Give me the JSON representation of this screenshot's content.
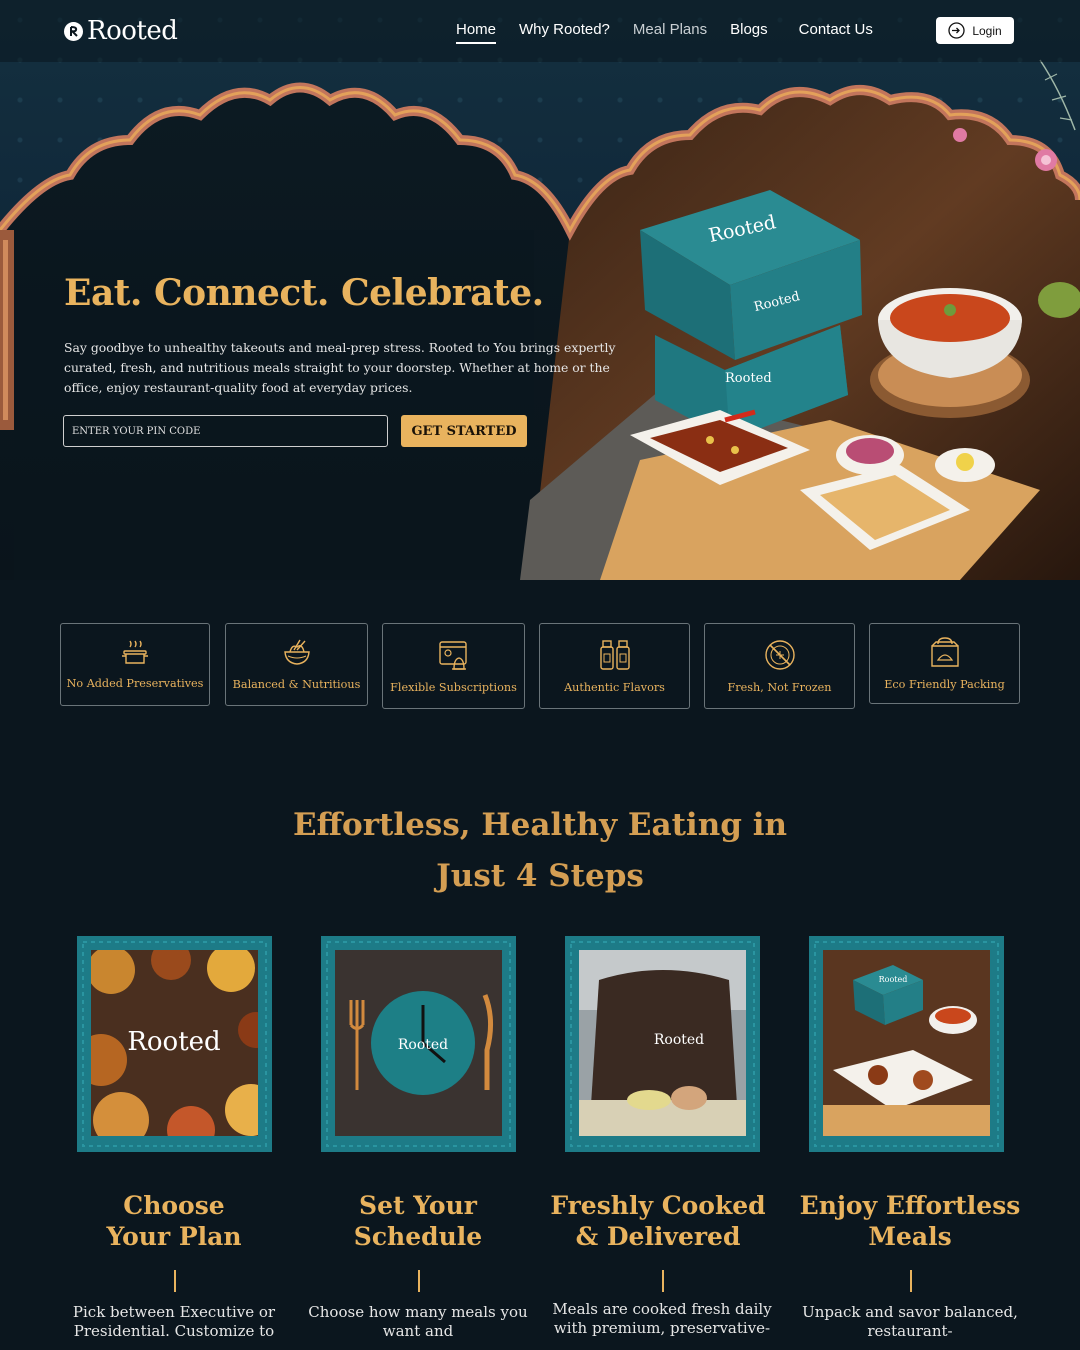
{
  "brand": {
    "name": "Rooted",
    "mark_letter": "R"
  },
  "nav": {
    "links": [
      {
        "label": "Home",
        "active": true
      },
      {
        "label": "Why Rooted?",
        "active": false
      },
      {
        "label": "Meal Plans",
        "active": false
      },
      {
        "label": "Blogs",
        "active": false
      },
      {
        "label": "Contact Us",
        "active": false
      }
    ],
    "login_label": "Login"
  },
  "hero": {
    "title": "Eat. Connect. Celebrate.",
    "description": "Say goodbye to unhealthy takeouts and meal-prep stress. Rooted to You brings expertly curated, fresh, and nutritious meals straight to your doorstep. Whether at home or the office, enjoy restaurant-quality food at everyday prices.",
    "pin_placeholder": "ENTER YOUR PIN CODE",
    "cta_label": "GET STARTED",
    "box_label": "Rooted"
  },
  "features": [
    {
      "label": "No Added Preservatives",
      "icon": "steaming-pot-icon"
    },
    {
      "label": "Balanced & Nutritious",
      "icon": "noodle-bowl-icon"
    },
    {
      "label": "Flexible Subscriptions",
      "icon": "calendar-bell-icon"
    },
    {
      "label": "Authentic Flavors",
      "icon": "spice-jars-icon"
    },
    {
      "label": "Fresh, Not Frozen",
      "icon": "no-frozen-icon"
    },
    {
      "label": "Eco Friendly Packing",
      "icon": "eco-bag-icon"
    }
  ],
  "steps_section": {
    "title_line1": "Effortless, Healthy Eating in",
    "title_line2": "Just 4 Steps"
  },
  "steps": [
    {
      "title_line1": "Choose",
      "title_line2": "Your Plan",
      "desc": "Pick between Executive or Presidential. Customize to",
      "image_label": "Rooted"
    },
    {
      "title_line1": "Set Your",
      "title_line2": "Schedule",
      "desc": "Choose how many meals you want and",
      "image_label": "Rooted"
    },
    {
      "title_line1": "Freshly Cooked",
      "title_line2": "& Delivered",
      "desc": "Meals are cooked fresh daily with premium, preservative-",
      "image_label": "Rooted"
    },
    {
      "title_line1": "Enjoy Effortless",
      "title_line2": "Meals",
      "desc": "Unpack and savor balanced, restaurant-",
      "image_label": "Rooted"
    }
  ],
  "colors": {
    "accent": "#e9b35e",
    "teal": "#1d7b87",
    "background": "#0b161e"
  }
}
